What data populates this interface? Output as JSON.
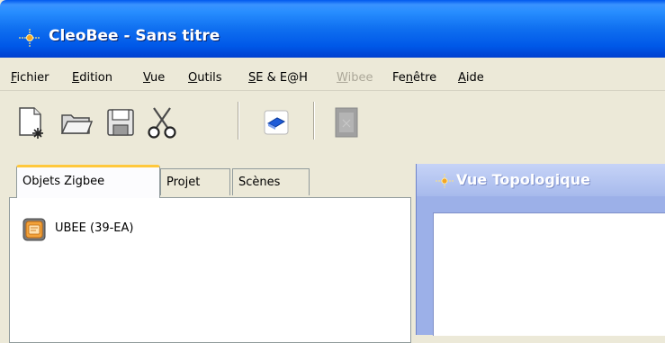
{
  "window": {
    "title": "CleoBee - Sans titre"
  },
  "menu": [
    {
      "label": "Fichier",
      "mnemonic": 0,
      "enabled": true
    },
    {
      "label": "Edition",
      "mnemonic": 0,
      "enabled": true
    },
    {
      "label": "Vue",
      "mnemonic": 0,
      "enabled": true
    },
    {
      "label": "Outils",
      "mnemonic": 0,
      "enabled": true
    },
    {
      "label": "SE & E@H",
      "mnemonic": 0,
      "enabled": true
    },
    {
      "label": "Wibee",
      "mnemonic": 0,
      "enabled": false
    },
    {
      "label": "Fenêtre",
      "mnemonic": 2,
      "enabled": true
    },
    {
      "label": "Aide",
      "mnemonic": 0,
      "enabled": true
    }
  ],
  "toolbar": {
    "buttons": [
      "new-file-icon",
      "open-folder-icon",
      "save-disk-icon",
      "cut-scissors-icon",
      "book-icon",
      "delete-icon"
    ]
  },
  "tabs": [
    {
      "label": "Objets Zigbee",
      "active": true
    },
    {
      "label": "Projet",
      "active": false
    },
    {
      "label": "Scènes",
      "active": false
    }
  ],
  "objects": [
    {
      "label": "UBEE (39-EA)",
      "icon": "ubee-device-icon"
    }
  ],
  "topology": {
    "title": "Vue Topologique"
  },
  "colors": {
    "title_bar": "#0058EE",
    "window_bg": "#ECE9D8",
    "active_tab_accent": "#FFC83C",
    "inactive_frame": "#A7BAEC"
  }
}
